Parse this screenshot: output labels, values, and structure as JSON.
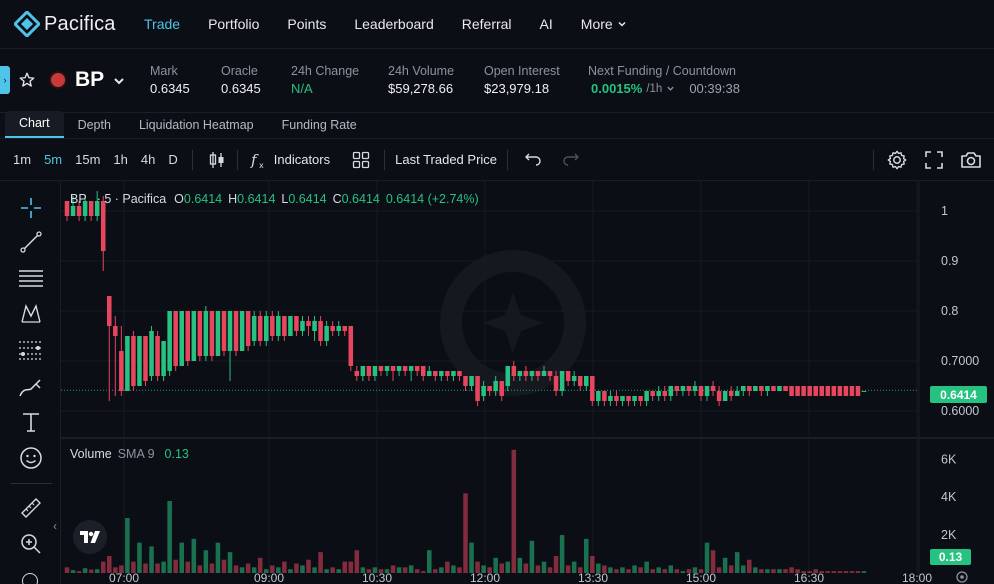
{
  "nav": {
    "logo_text": "Pacifica",
    "items": [
      "Trade",
      "Portfolio",
      "Points",
      "Leaderboard",
      "Referral",
      "AI"
    ],
    "more_label": "More",
    "active": "Trade"
  },
  "ticker": {
    "symbol": "BP",
    "mark_label": "Mark",
    "mark_value": "0.6345",
    "oracle_label": "Oracle",
    "oracle_value": "0.6345",
    "change_label": "24h Change",
    "change_value": "N/A",
    "volume_label": "24h Volume",
    "volume_value": "$59,278.66",
    "oi_label": "Open Interest",
    "oi_value": "$23,979.18",
    "funding_label": "Next Funding / Countdown",
    "funding_rate": "0.0015%",
    "funding_interval": "/1h",
    "countdown": "00:39:38"
  },
  "tabs": [
    "Chart",
    "Depth",
    "Liquidation Heatmap",
    "Funding Rate"
  ],
  "toolbar": {
    "timeframes": [
      "1m",
      "5m",
      "15m",
      "1h",
      "4h",
      "D"
    ],
    "active_timeframe": "5m",
    "indicators_label": "Indicators",
    "price_source_label": "Last Traded Price"
  },
  "legend": {
    "symbol": "BP",
    "interval": "5",
    "exchange": "Pacifica",
    "o_label": "O",
    "o": "0.6414",
    "h_label": "H",
    "h": "0.6414",
    "l_label": "L",
    "l": "0.6414",
    "c_label": "C",
    "c": "0.6414",
    "change": "0.6414 (+2.74%)",
    "volume_label": "Volume",
    "sma_label": "SMA 9",
    "sma_value": "0.13"
  },
  "colors": {
    "up": "#26c281",
    "down": "#e8455f",
    "accent": "#4fc3e8"
  },
  "chart_data": {
    "type": "candlestick",
    "price_axis_ticks": [
      "1",
      "0.9",
      "0.8",
      "0.7000",
      "0.6000"
    ],
    "price_axis_values": [
      1,
      0.9,
      0.8,
      0.7,
      0.6
    ],
    "volume_axis_ticks": [
      "6K",
      "4K",
      "2K"
    ],
    "volume_axis_values": [
      6000,
      4000,
      2000
    ],
    "time_ticks": [
      "07:00",
      "09:00",
      "10:30",
      "12:00",
      "13:30",
      "15:00",
      "16:30",
      "18:00"
    ],
    "last_price": "0.6414",
    "last_volume": "0.13",
    "ylim": [
      0.55,
      1.04
    ],
    "vol_max": 6700,
    "candles": [
      {
        "o": 1.02,
        "c": 0.99,
        "h": 1.02,
        "l": 0.98,
        "v": 300
      },
      {
        "o": 0.99,
        "c": 1.01,
        "h": 1.03,
        "l": 0.99,
        "v": 150
      },
      {
        "o": 1.01,
        "c": 0.99,
        "h": 1.02,
        "l": 0.98,
        "v": 100
      },
      {
        "o": 0.99,
        "c": 1.02,
        "h": 1.03,
        "l": 0.98,
        "v": 250
      },
      {
        "o": 1.02,
        "c": 0.99,
        "h": 1.02,
        "l": 0.98,
        "v": 180
      },
      {
        "o": 0.99,
        "c": 1.02,
        "h": 1.04,
        "l": 0.98,
        "v": 200
      },
      {
        "o": 1.02,
        "c": 0.92,
        "h": 1.03,
        "l": 0.88,
        "v": 600
      },
      {
        "o": 0.83,
        "c": 0.77,
        "h": 0.83,
        "l": 0.62,
        "v": 900
      },
      {
        "o": 0.77,
        "c": 0.75,
        "h": 0.79,
        "l": 0.63,
        "v": 300
      },
      {
        "o": 0.72,
        "c": 0.64,
        "h": 0.77,
        "l": 0.63,
        "v": 400
      },
      {
        "o": 0.64,
        "c": 0.75,
        "h": 0.75,
        "l": 0.64,
        "v": 2900
      },
      {
        "o": 0.75,
        "c": 0.65,
        "h": 0.76,
        "l": 0.64,
        "v": 600
      },
      {
        "o": 0.65,
        "c": 0.75,
        "h": 0.75,
        "l": 0.65,
        "v": 1600
      },
      {
        "o": 0.75,
        "c": 0.66,
        "h": 0.75,
        "l": 0.65,
        "v": 500
      },
      {
        "o": 0.67,
        "c": 0.76,
        "h": 0.77,
        "l": 0.66,
        "v": 1400
      },
      {
        "o": 0.75,
        "c": 0.67,
        "h": 0.76,
        "l": 0.66,
        "v": 500
      },
      {
        "o": 0.67,
        "c": 0.74,
        "h": 0.74,
        "l": 0.66,
        "v": 600
      },
      {
        "o": 0.68,
        "c": 0.8,
        "h": 0.8,
        "l": 0.67,
        "v": 3800
      },
      {
        "o": 0.8,
        "c": 0.69,
        "h": 0.8,
        "l": 0.68,
        "v": 700
      },
      {
        "o": 0.69,
        "c": 0.8,
        "h": 0.8,
        "l": 0.69,
        "v": 1600
      },
      {
        "o": 0.8,
        "c": 0.7,
        "h": 0.8,
        "l": 0.69,
        "v": 600
      },
      {
        "o": 0.7,
        "c": 0.8,
        "h": 0.8,
        "l": 0.7,
        "v": 1800
      },
      {
        "o": 0.8,
        "c": 0.71,
        "h": 0.8,
        "l": 0.7,
        "v": 400
      },
      {
        "o": 0.71,
        "c": 0.8,
        "h": 0.81,
        "l": 0.7,
        "v": 1200
      },
      {
        "o": 0.8,
        "c": 0.71,
        "h": 0.8,
        "l": 0.7,
        "v": 500
      },
      {
        "o": 0.71,
        "c": 0.8,
        "h": 0.8,
        "l": 0.71,
        "v": 1600
      },
      {
        "o": 0.8,
        "c": 0.72,
        "h": 0.8,
        "l": 0.71,
        "v": 700
      },
      {
        "o": 0.72,
        "c": 0.8,
        "h": 0.8,
        "l": 0.66,
        "v": 1100
      },
      {
        "o": 0.8,
        "c": 0.72,
        "h": 0.8,
        "l": 0.71,
        "v": 400
      },
      {
        "o": 0.72,
        "c": 0.8,
        "h": 0.8,
        "l": 0.72,
        "v": 300
      },
      {
        "o": 0.8,
        "c": 0.73,
        "h": 0.8,
        "l": 0.72,
        "v": 500
      },
      {
        "o": 0.74,
        "c": 0.79,
        "h": 0.8,
        "l": 0.73,
        "v": 300
      },
      {
        "o": 0.79,
        "c": 0.74,
        "h": 0.8,
        "l": 0.73,
        "v": 800
      },
      {
        "o": 0.74,
        "c": 0.79,
        "h": 0.8,
        "l": 0.73,
        "v": 200
      },
      {
        "o": 0.79,
        "c": 0.75,
        "h": 0.8,
        "l": 0.74,
        "v": 400
      },
      {
        "o": 0.75,
        "c": 0.79,
        "h": 0.8,
        "l": 0.74,
        "v": 300
      },
      {
        "o": 0.79,
        "c": 0.75,
        "h": 0.79,
        "l": 0.74,
        "v": 600
      },
      {
        "o": 0.75,
        "c": 0.79,
        "h": 0.79,
        "l": 0.75,
        "v": 200
      },
      {
        "o": 0.79,
        "c": 0.76,
        "h": 0.79,
        "l": 0.75,
        "v": 500
      },
      {
        "o": 0.76,
        "c": 0.78,
        "h": 0.79,
        "l": 0.75,
        "v": 400
      },
      {
        "o": 0.78,
        "c": 0.77,
        "h": 0.79,
        "l": 0.75,
        "v": 700
      },
      {
        "o": 0.76,
        "c": 0.78,
        "h": 0.79,
        "l": 0.74,
        "v": 300
      },
      {
        "o": 0.78,
        "c": 0.74,
        "h": 0.79,
        "l": 0.73,
        "v": 1100
      },
      {
        "o": 0.74,
        "c": 0.77,
        "h": 0.78,
        "l": 0.73,
        "v": 200
      },
      {
        "o": 0.77,
        "c": 0.76,
        "h": 0.78,
        "l": 0.75,
        "v": 300
      },
      {
        "o": 0.76,
        "c": 0.77,
        "h": 0.78,
        "l": 0.75,
        "v": 200
      },
      {
        "o": 0.77,
        "c": 0.76,
        "h": 0.77,
        "l": 0.75,
        "v": 600
      },
      {
        "o": 0.77,
        "c": 0.69,
        "h": 0.77,
        "l": 0.68,
        "v": 600
      },
      {
        "o": 0.68,
        "c": 0.67,
        "h": 0.69,
        "l": 0.66,
        "v": 1200
      },
      {
        "o": 0.67,
        "c": 0.69,
        "h": 0.69,
        "l": 0.66,
        "v": 300
      },
      {
        "o": 0.69,
        "c": 0.67,
        "h": 0.69,
        "l": 0.66,
        "v": 200
      },
      {
        "o": 0.67,
        "c": 0.69,
        "h": 0.69,
        "l": 0.66,
        "v": 300
      },
      {
        "o": 0.69,
        "c": 0.68,
        "h": 0.69,
        "l": 0.67,
        "v": 200
      },
      {
        "o": 0.68,
        "c": 0.69,
        "h": 0.69,
        "l": 0.67,
        "v": 200
      },
      {
        "o": 0.69,
        "c": 0.68,
        "h": 0.69,
        "l": 0.66,
        "v": 400
      },
      {
        "o": 0.68,
        "c": 0.69,
        "h": 0.69,
        "l": 0.67,
        "v": 300
      },
      {
        "o": 0.69,
        "c": 0.68,
        "h": 0.69,
        "l": 0.67,
        "v": 300
      },
      {
        "o": 0.68,
        "c": 0.69,
        "h": 0.69,
        "l": 0.66,
        "v": 400
      },
      {
        "o": 0.69,
        "c": 0.68,
        "h": 0.69,
        "l": 0.67,
        "v": 200
      },
      {
        "o": 0.69,
        "c": 0.67,
        "h": 0.69,
        "l": 0.66,
        "v": 100
      },
      {
        "o": 0.67,
        "c": 0.68,
        "h": 0.69,
        "l": 0.67,
        "v": 1200
      },
      {
        "o": 0.68,
        "c": 0.67,
        "h": 0.68,
        "l": 0.66,
        "v": 200
      },
      {
        "o": 0.67,
        "c": 0.68,
        "h": 0.68,
        "l": 0.66,
        "v": 300
      },
      {
        "o": 0.68,
        "c": 0.67,
        "h": 0.68,
        "l": 0.66,
        "v": 600
      },
      {
        "o": 0.67,
        "c": 0.68,
        "h": 0.68,
        "l": 0.66,
        "v": 400
      },
      {
        "o": 0.68,
        "c": 0.67,
        "h": 0.68,
        "l": 0.66,
        "v": 300
      },
      {
        "o": 0.67,
        "c": 0.65,
        "h": 0.67,
        "l": 0.64,
        "v": 4200
      },
      {
        "o": 0.65,
        "c": 0.67,
        "h": 0.67,
        "l": 0.64,
        "v": 1600
      },
      {
        "o": 0.67,
        "c": 0.62,
        "h": 0.67,
        "l": 0.61,
        "v": 600
      },
      {
        "o": 0.63,
        "c": 0.65,
        "h": 0.66,
        "l": 0.62,
        "v": 400
      },
      {
        "o": 0.65,
        "c": 0.64,
        "h": 0.65,
        "l": 0.63,
        "v": 300
      },
      {
        "o": 0.64,
        "c": 0.66,
        "h": 0.67,
        "l": 0.63,
        "v": 800
      },
      {
        "o": 0.66,
        "c": 0.63,
        "h": 0.66,
        "l": 0.62,
        "v": 500
      },
      {
        "o": 0.65,
        "c": 0.69,
        "h": 0.69,
        "l": 0.64,
        "v": 600
      },
      {
        "o": 0.69,
        "c": 0.67,
        "h": 0.7,
        "l": 0.66,
        "v": 6500
      },
      {
        "o": 0.67,
        "c": 0.68,
        "h": 0.68,
        "l": 0.66,
        "v": 800
      },
      {
        "o": 0.68,
        "c": 0.67,
        "h": 0.69,
        "l": 0.66,
        "v": 500
      },
      {
        "o": 0.67,
        "c": 0.68,
        "h": 0.68,
        "l": 0.66,
        "v": 1700
      },
      {
        "o": 0.68,
        "c": 0.67,
        "h": 0.68,
        "l": 0.66,
        "v": 400
      },
      {
        "o": 0.67,
        "c": 0.68,
        "h": 0.69,
        "l": 0.67,
        "v": 600
      },
      {
        "o": 0.68,
        "c": 0.67,
        "h": 0.68,
        "l": 0.66,
        "v": 300
      },
      {
        "o": 0.67,
        "c": 0.64,
        "h": 0.68,
        "l": 0.63,
        "v": 900
      },
      {
        "o": 0.64,
        "c": 0.68,
        "h": 0.68,
        "l": 0.63,
        "v": 2000
      },
      {
        "o": 0.68,
        "c": 0.66,
        "h": 0.68,
        "l": 0.65,
        "v": 400
      },
      {
        "o": 0.66,
        "c": 0.67,
        "h": 0.68,
        "l": 0.65,
        "v": 600
      },
      {
        "o": 0.67,
        "c": 0.65,
        "h": 0.67,
        "l": 0.64,
        "v": 300
      },
      {
        "o": 0.65,
        "c": 0.67,
        "h": 0.67,
        "l": 0.64,
        "v": 1800
      },
      {
        "o": 0.67,
        "c": 0.62,
        "h": 0.67,
        "l": 0.61,
        "v": 900
      },
      {
        "o": 0.62,
        "c": 0.64,
        "h": 0.64,
        "l": 0.61,
        "v": 500
      },
      {
        "o": 0.64,
        "c": 0.62,
        "h": 0.64,
        "l": 0.61,
        "v": 400
      },
      {
        "o": 0.62,
        "c": 0.63,
        "h": 0.64,
        "l": 0.61,
        "v": 300
      },
      {
        "o": 0.63,
        "c": 0.62,
        "h": 0.64,
        "l": 0.61,
        "v": 200
      },
      {
        "o": 0.62,
        "c": 0.63,
        "h": 0.63,
        "l": 0.61,
        "v": 300
      },
      {
        "o": 0.63,
        "c": 0.62,
        "h": 0.63,
        "l": 0.61,
        "v": 200
      },
      {
        "o": 0.62,
        "c": 0.63,
        "h": 0.63,
        "l": 0.61,
        "v": 400
      },
      {
        "o": 0.63,
        "c": 0.62,
        "h": 0.63,
        "l": 0.61,
        "v": 300
      },
      {
        "o": 0.62,
        "c": 0.64,
        "h": 0.64,
        "l": 0.61,
        "v": 600
      },
      {
        "o": 0.64,
        "c": 0.63,
        "h": 0.64,
        "l": 0.62,
        "v": 200
      },
      {
        "o": 0.63,
        "c": 0.64,
        "h": 0.65,
        "l": 0.62,
        "v": 300
      },
      {
        "o": 0.64,
        "c": 0.63,
        "h": 0.65,
        "l": 0.62,
        "v": 200
      },
      {
        "o": 0.63,
        "c": 0.65,
        "h": 0.65,
        "l": 0.62,
        "v": 400
      },
      {
        "o": 0.65,
        "c": 0.64,
        "h": 0.65,
        "l": 0.63,
        "v": 200
      },
      {
        "o": 0.64,
        "c": 0.65,
        "h": 0.65,
        "l": 0.63,
        "v": 100
      },
      {
        "o": 0.65,
        "c": 0.64,
        "h": 0.65,
        "l": 0.63,
        "v": 200
      },
      {
        "o": 0.64,
        "c": 0.65,
        "h": 0.66,
        "l": 0.63,
        "v": 300
      },
      {
        "o": 0.65,
        "c": 0.63,
        "h": 0.65,
        "l": 0.62,
        "v": 200
      },
      {
        "o": 0.63,
        "c": 0.65,
        "h": 0.65,
        "l": 0.62,
        "v": 1600
      },
      {
        "o": 0.65,
        "c": 0.64,
        "h": 0.66,
        "l": 0.63,
        "v": 1200
      },
      {
        "o": 0.64,
        "c": 0.62,
        "h": 0.65,
        "l": 0.61,
        "v": 300
      },
      {
        "o": 0.62,
        "c": 0.64,
        "h": 0.64,
        "l": 0.62,
        "v": 800
      },
      {
        "o": 0.64,
        "c": 0.63,
        "h": 0.65,
        "l": 0.62,
        "v": 400
      },
      {
        "o": 0.63,
        "c": 0.64,
        "h": 0.65,
        "l": 0.63,
        "v": 1100
      },
      {
        "o": 0.64,
        "c": 0.65,
        "h": 0.65,
        "l": 0.63,
        "v": 400
      },
      {
        "o": 0.65,
        "c": 0.64,
        "h": 0.65,
        "l": 0.63,
        "v": 700
      },
      {
        "o": 0.64,
        "c": 0.65,
        "h": 0.65,
        "l": 0.64,
        "v": 300
      },
      {
        "o": 0.65,
        "c": 0.64,
        "h": 0.65,
        "l": 0.63,
        "v": 200
      },
      {
        "o": 0.64,
        "c": 0.65,
        "h": 0.65,
        "l": 0.63,
        "v": 200
      },
      {
        "o": 0.65,
        "c": 0.64,
        "h": 0.65,
        "l": 0.64,
        "v": 200
      },
      {
        "o": 0.64,
        "c": 0.65,
        "h": 0.65,
        "l": 0.64,
        "v": 200
      },
      {
        "o": 0.65,
        "c": 0.64,
        "h": 0.65,
        "l": 0.64,
        "v": 200
      },
      {
        "o": 0.65,
        "c": 0.63,
        "h": 0.65,
        "l": 0.63,
        "v": 300
      },
      {
        "o": 0.65,
        "c": 0.63,
        "h": 0.65,
        "l": 0.63,
        "v": 200
      },
      {
        "o": 0.65,
        "c": 0.63,
        "h": 0.65,
        "l": 0.63,
        "v": 100
      },
      {
        "o": 0.65,
        "c": 0.63,
        "h": 0.65,
        "l": 0.63,
        "v": 100
      },
      {
        "o": 0.65,
        "c": 0.63,
        "h": 0.65,
        "l": 0.63,
        "v": 200
      },
      {
        "o": 0.65,
        "c": 0.63,
        "h": 0.65,
        "l": 0.63,
        "v": 100
      },
      {
        "o": 0.65,
        "c": 0.63,
        "h": 0.65,
        "l": 0.63,
        "v": 100
      },
      {
        "o": 0.65,
        "c": 0.63,
        "h": 0.65,
        "l": 0.63,
        "v": 100
      },
      {
        "o": 0.65,
        "c": 0.63,
        "h": 0.65,
        "l": 0.63,
        "v": 100
      },
      {
        "o": 0.65,
        "c": 0.63,
        "h": 0.65,
        "l": 0.63,
        "v": 100
      },
      {
        "o": 0.65,
        "c": 0.63,
        "h": 0.65,
        "l": 0.63,
        "v": 100
      },
      {
        "o": 0.65,
        "c": 0.63,
        "h": 0.65,
        "l": 0.63,
        "v": 100
      },
      {
        "o": 0.64,
        "c": 0.64,
        "h": 0.64,
        "l": 0.64,
        "v": 100
      }
    ]
  }
}
